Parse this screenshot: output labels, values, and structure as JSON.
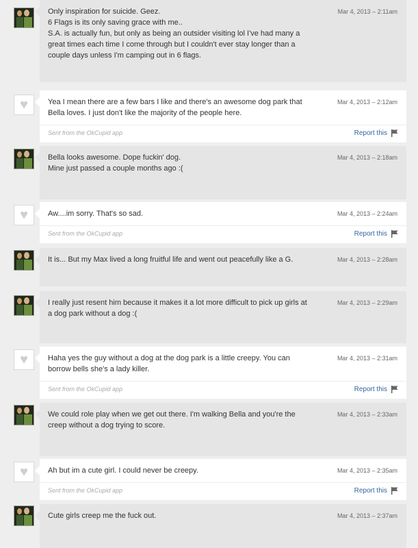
{
  "messages": [
    {
      "side": "theirs",
      "text": "Only inspiration for suicide. Geez.\n6 Flags is its only saving grace with me..\nS.A. is actually fun, but only as being an outsider visiting lol I've had many a great times each time I come through but I couldn't ever stay longer than a couple days unless I'm camping out in 6 flags.",
      "time": "Mar 4, 2013 – 2:11am"
    },
    {
      "side": "mine",
      "text": "Yea I mean there are a few bars I like and there's an awesome dog park that Bella loves. I just don't like the majority of the people here.",
      "time": "Mar 4, 2013 – 2:12am",
      "sent_from": "Sent from the OkCupid app",
      "report": "Report this"
    },
    {
      "side": "theirs",
      "text": "Bella looks awesome. Dope fuckin' dog.\nMine just passed a couple months ago :(",
      "time": "Mar 4, 2013 – 2:18am"
    },
    {
      "side": "mine",
      "text": "Aw....im sorry. That's so sad.",
      "time": "Mar 4, 2013 – 2:24am",
      "sent_from": "Sent from the OkCupid app",
      "report": "Report this"
    },
    {
      "side": "theirs",
      "text": "It is... But my Max lived a long fruitful life and went out peacefully like a G.",
      "time": "Mar 4, 2013 – 2:28am"
    },
    {
      "side": "theirs",
      "text": "I really just resent him because it makes it a lot more difficult to pick up girls at a dog park without a dog :(",
      "time": "Mar 4, 2013 – 2:29am"
    },
    {
      "side": "mine",
      "text": "Haha yes the guy without a dog at the dog park is a little creepy. You can borrow bells she's a lady killer.",
      "time": "Mar 4, 2013 – 2:31am",
      "sent_from": "Sent from the OkCupid app",
      "report": "Report this"
    },
    {
      "side": "theirs",
      "text": "We could role play when we get out there. I'm walking Bella and you're the creep without a dog trying to score.",
      "time": "Mar 4, 2013 – 2:33am"
    },
    {
      "side": "mine",
      "text": "Ah but im a cute girl. I could never be creepy.",
      "time": "Mar 4, 2013 – 2:35am",
      "sent_from": "Sent from the OkCupid app",
      "report": "Report this"
    },
    {
      "side": "theirs",
      "text": "Cute girls creep me the fuck out.",
      "time": "Mar 4, 2013 – 2:37am"
    }
  ],
  "icons": {
    "avatar_mine": "heart-icon",
    "report": "flag-icon"
  },
  "colors": {
    "link": "#3764a0",
    "theirs_bg": "#e5e5e5",
    "mine_bg": "#ffffff"
  }
}
